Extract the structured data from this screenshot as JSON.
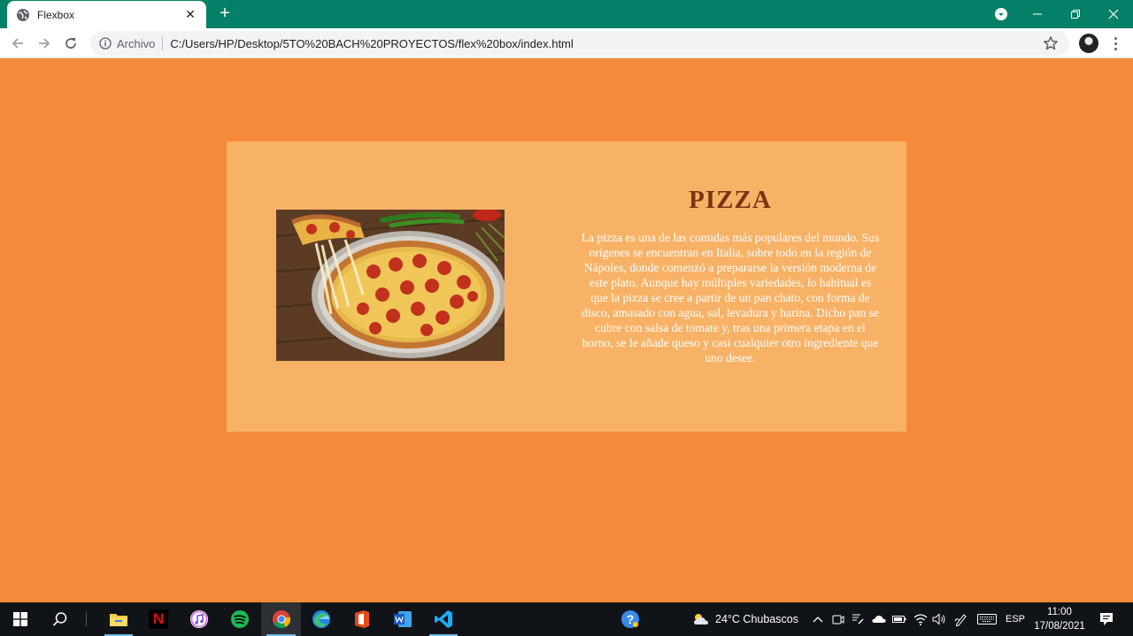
{
  "browser": {
    "tab_title": "Flexbox",
    "new_tab_symbol": "+",
    "security_label": "Archivo",
    "url": "C:/Users/HP/Desktop/5TO%20BACH%20PROYECTOS/flex%20box/index.html",
    "icons": [
      "globe-icon",
      "close-icon",
      "plus-icon",
      "profile-dropdown-icon",
      "minimize-icon",
      "restore-icon",
      "window-close-icon",
      "back-icon",
      "forward-icon",
      "reload-icon",
      "info-icon",
      "star-icon",
      "avatar",
      "kebab-menu-icon"
    ]
  },
  "page": {
    "heading": "PIZZA",
    "description": "La pizza es una de las comidas más populares del mundo. Sus orígenes se encuentran en Italia, sobre todo en la región de Nápoles, donde comenzó a prepararse la versión moderna de este plato. Aunque hay múltiples variedades, lo habitual es que la pizza se cree a partir de un pan chato, con forma de disco, amasado con agua, sal, levadura y harina. Dicho pan se cubre con salsa de tomate y, tras una primera etapa en el horno, se le añade queso y casi cualquier otro ingrediente que uno desee.",
    "image": "pepperoni-pizza-photo",
    "colors": {
      "background": "#f58b3a",
      "card": "#f8b266",
      "heading": "#7a3414",
      "text": "#ffffff"
    }
  },
  "taskbar": {
    "apps": [
      "windows-start-icon",
      "search-icon",
      "file-explorer-icon",
      "netflix-icon",
      "itunes-icon",
      "spotify-icon",
      "chrome-icon",
      "edge-icon",
      "office-icon",
      "word-icon",
      "vscode-icon"
    ],
    "weather": "24°C  Chubascos",
    "language": "ESP",
    "time": "11:00",
    "date": "17/08/2021"
  }
}
